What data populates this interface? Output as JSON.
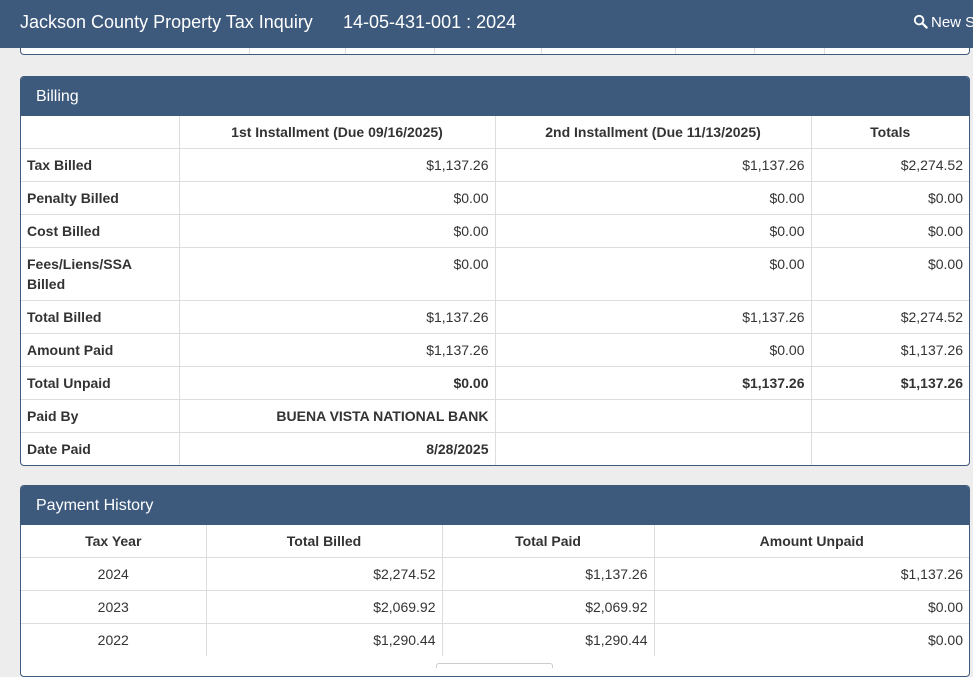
{
  "navbar": {
    "title": "Jackson County Property Tax Inquiry",
    "parcel": "14-05-431-001 : 2024",
    "new_search_label": "New S",
    "search_icon": "search-icon",
    "background": "#3d5a7d"
  },
  "billing": {
    "heading": "Billing",
    "columns": [
      "",
      "1st Installment (Due 09/16/2025)",
      "2nd Installment (Due 11/13/2025)",
      "Totals"
    ],
    "rows": [
      {
        "label": "Tax Billed",
        "first": "$1,137.26",
        "second": "$1,137.26",
        "total": "$2,274.52"
      },
      {
        "label": "Penalty Billed",
        "first": "$0.00",
        "second": "$0.00",
        "total": "$0.00"
      },
      {
        "label": "Cost Billed",
        "first": "$0.00",
        "second": "$0.00",
        "total": "$0.00"
      },
      {
        "label": "Fees/Liens/SSA Billed",
        "first": "$0.00",
        "second": "$0.00",
        "total": "$0.00"
      },
      {
        "label": "Total Billed",
        "first": "$1,137.26",
        "second": "$1,137.26",
        "total": "$2,274.52"
      },
      {
        "label": "Amount Paid",
        "first": "$1,137.26",
        "second": "$0.00",
        "total": "$1,137.26"
      },
      {
        "label": "Total Unpaid",
        "first": "$0.00",
        "second": "$1,137.26",
        "total": "$1,137.26"
      },
      {
        "label": "Paid By",
        "first": "BUENA VISTA NATIONAL BANK",
        "second": "",
        "total": ""
      },
      {
        "label": "Date Paid",
        "first": "8/28/2025",
        "second": "",
        "total": ""
      }
    ]
  },
  "payment_history": {
    "heading": "Payment History",
    "columns": [
      "Tax Year",
      "Total Billed",
      "Total Paid",
      "Amount Unpaid"
    ],
    "rows": [
      {
        "year": "2024",
        "billed": "$2,274.52",
        "paid": "$1,137.26",
        "unpaid": "$1,137.26"
      },
      {
        "year": "2023",
        "billed": "$2,069.92",
        "paid": "$2,069.92",
        "unpaid": "$0.00"
      },
      {
        "year": "2022",
        "billed": "$1,290.44",
        "paid": "$1,290.44",
        "unpaid": "$0.00"
      }
    ]
  }
}
